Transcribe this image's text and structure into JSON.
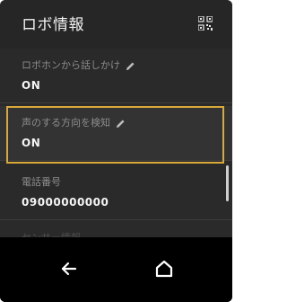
{
  "header": {
    "title": "ロボ情報",
    "qr_icon": "qr-code-icon"
  },
  "settings": [
    {
      "label": "ロボホンから話しかけ",
      "value": "ON",
      "editable": true
    },
    {
      "label": "声のする方向を検知",
      "value": "ON",
      "editable": true,
      "selected": true
    },
    {
      "label": "電話番号",
      "value": "09000000000",
      "editable": false
    },
    {
      "label": "センサー情報",
      "value": "",
      "editable": false
    }
  ],
  "navbar": {
    "back_icon": "back-arrow-icon",
    "home_icon": "home-icon"
  },
  "colors": {
    "header_bg": "#262626",
    "list_bg": "#2a2a2a",
    "label_color": "#8c8c8c",
    "value_color": "#f5f5f5",
    "highlight": "#d9a93a",
    "navbar_bg": "#000000"
  }
}
